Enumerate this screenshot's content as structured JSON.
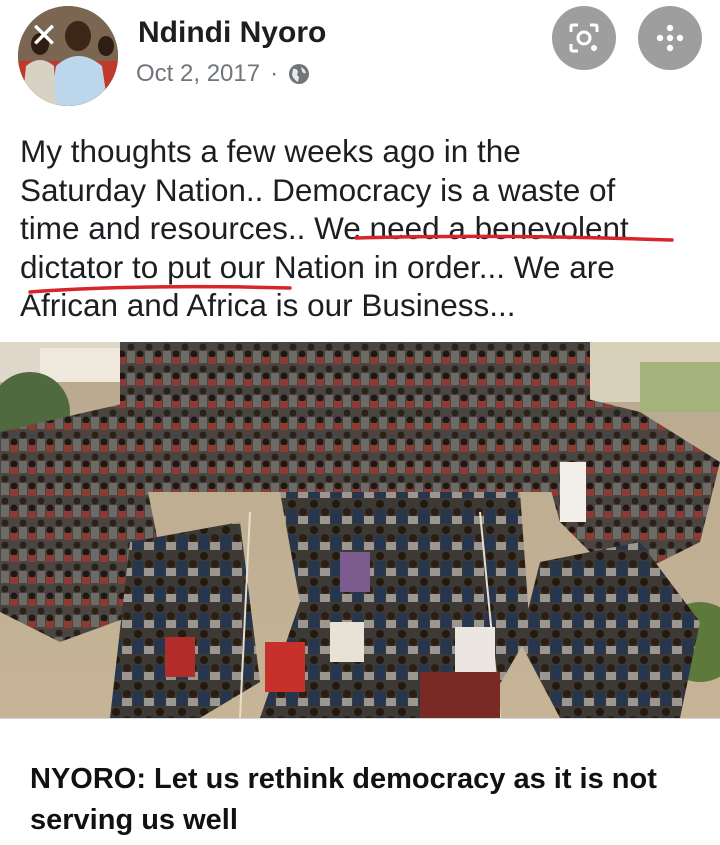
{
  "post": {
    "author": "Ndindi Nyoro",
    "date": "Oct 2, 2017",
    "separator": "·",
    "privacy_icon": "globe-icon",
    "text_lines": [
      "My thoughts a few weeks ago in the",
      "Saturday Nation.. Democracy is a waste of",
      "time and resources.. We need a benevolent",
      "dictator to put our Nation in order... We are",
      "African and Africa is our Business..."
    ],
    "annotation_color": "#d8242b"
  },
  "toolbar": {
    "close_icon": "close-icon",
    "lens_icon": "lens-icon",
    "more_icon": "more-icon"
  },
  "link_card": {
    "title": "NYORO: Let us rethink democracy as it is not serving us well"
  }
}
